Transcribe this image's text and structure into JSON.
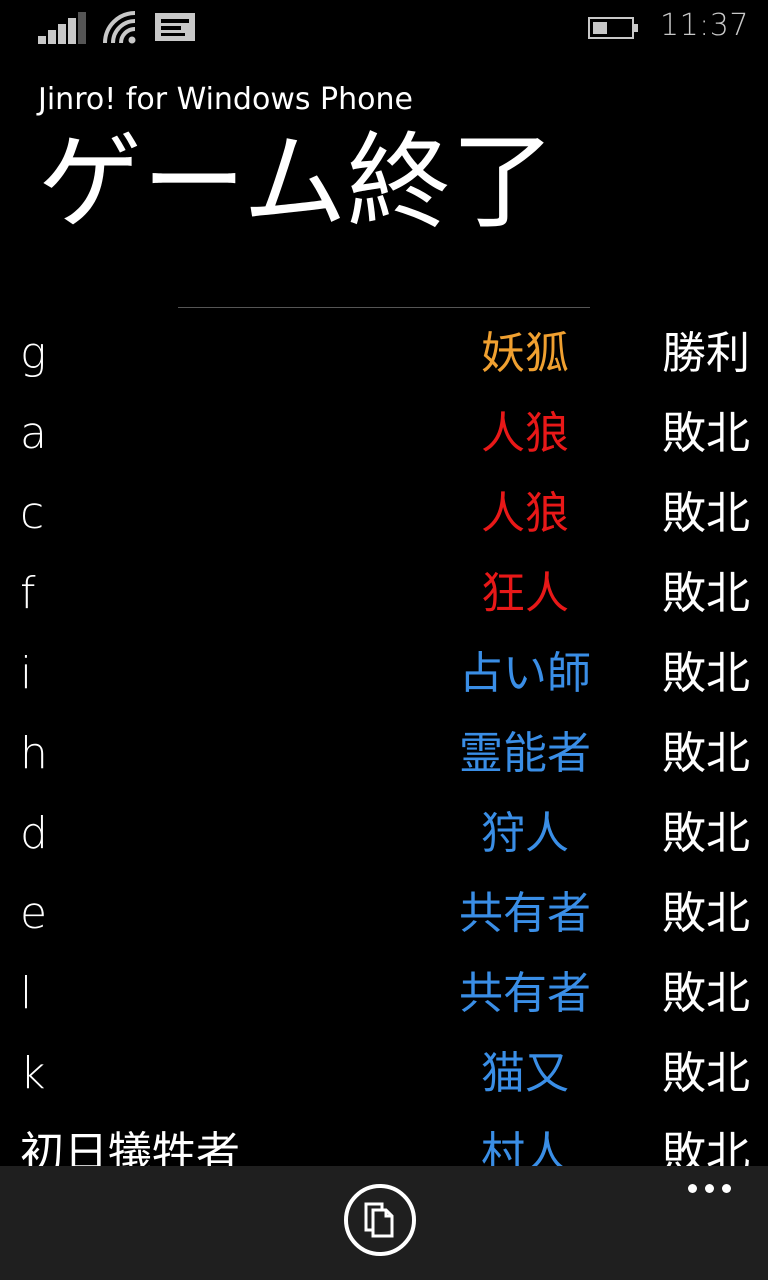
{
  "status_bar": {
    "time": "11:37",
    "signal_icon": "signal-bars-icon",
    "wifi_icon": "wifi-icon",
    "message_icon": "message-icon",
    "battery_icon": "battery-icon"
  },
  "header": {
    "app_title": "Jinro! for Windows Phone",
    "page_title": "ゲーム終了"
  },
  "colors": {
    "fox": "#f0a030",
    "wolf": "#e81818",
    "village": "#3a8ee6",
    "text": "#ffffff",
    "app_bar": "#1f1f1f"
  },
  "results": [
    {
      "player": "g",
      "role": "妖狐",
      "team": "fox",
      "result": "勝利"
    },
    {
      "player": "a",
      "role": "人狼",
      "team": "wolf",
      "result": "敗北"
    },
    {
      "player": "c",
      "role": "人狼",
      "team": "wolf",
      "result": "敗北"
    },
    {
      "player": "f",
      "role": "狂人",
      "team": "wolf",
      "result": "敗北"
    },
    {
      "player": "i",
      "role": "占い師",
      "team": "village",
      "result": "敗北"
    },
    {
      "player": "h",
      "role": "霊能者",
      "team": "village",
      "result": "敗北"
    },
    {
      "player": "d",
      "role": "狩人",
      "team": "village",
      "result": "敗北"
    },
    {
      "player": "e",
      "role": "共有者",
      "team": "village",
      "result": "敗北"
    },
    {
      "player": "l",
      "role": "共有者",
      "team": "village",
      "result": "敗北"
    },
    {
      "player": "k",
      "role": "猫又",
      "team": "village",
      "result": "敗北"
    },
    {
      "player": "初日犠牲者",
      "role": "村人",
      "team": "village",
      "result": "敗北"
    }
  ],
  "app_bar": {
    "copy_icon": "copy-icon",
    "more_icon": "more-dots-icon"
  }
}
